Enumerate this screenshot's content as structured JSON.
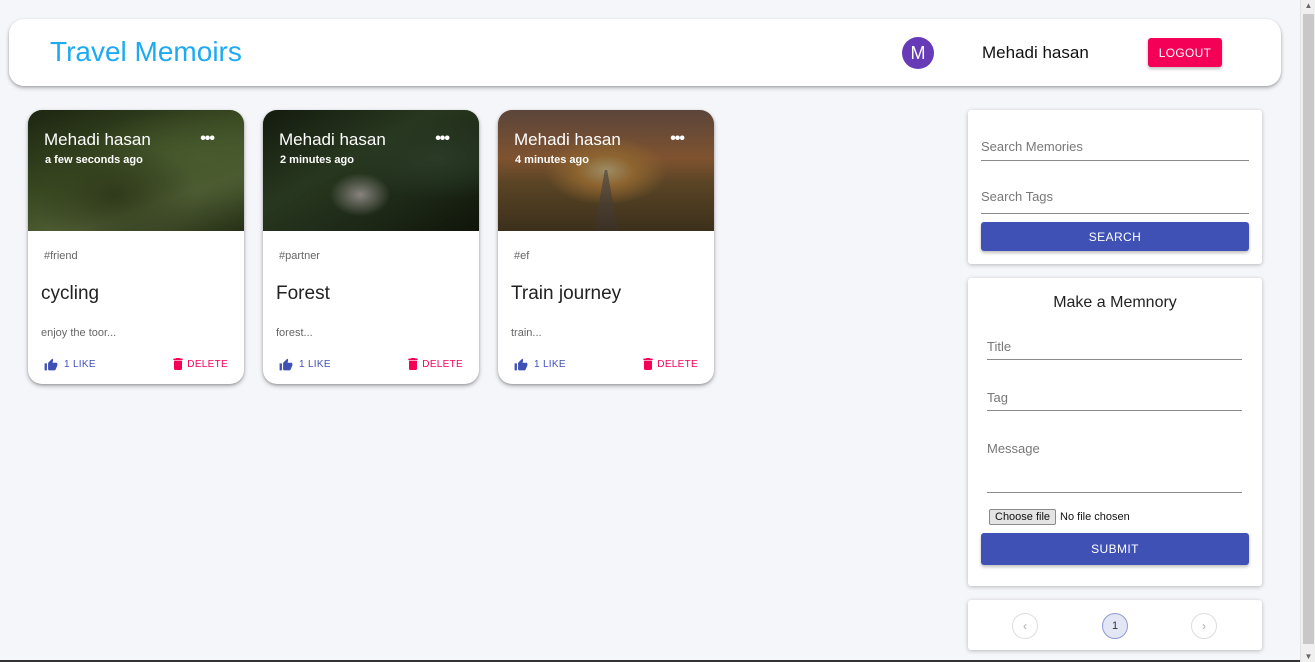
{
  "app": {
    "title": "Travel Memoirs",
    "avatar_letter": "M",
    "user_name": "Mehadi hasan",
    "logout_label": "LOGOUT",
    "brand_color": "#1eaaf1",
    "avatar_color": "#673ab7",
    "logout_color": "#f50057"
  },
  "posts": [
    {
      "author": "Mehadi hasan",
      "time": "a few seconds ago",
      "more_icon": "more-horizontal-icon",
      "tags": "#friend",
      "title": "cycling",
      "message": "enjoy the toor...",
      "like_label": "1 LIKE",
      "delete_label": "DELETE"
    },
    {
      "author": "Mehadi hasan",
      "time": "2 minutes ago",
      "more_icon": "more-horizontal-icon",
      "tags": "#partner",
      "title": "Forest",
      "message": "forest...",
      "like_label": "1 LIKE",
      "delete_label": "DELETE"
    },
    {
      "author": "Mehadi hasan",
      "time": "4 minutes ago",
      "more_icon": "more-horizontal-icon",
      "tags": "#ef",
      "title": "Train journey",
      "message": "train...",
      "like_label": "1 LIKE",
      "delete_label": "DELETE"
    }
  ],
  "search": {
    "memories_placeholder": "Search Memories",
    "tags_placeholder": "Search Tags",
    "button_label": "SEARCH"
  },
  "form": {
    "heading": "Make a Memnory",
    "title_placeholder": "Title",
    "tag_placeholder": "Tag",
    "message_placeholder": "Message",
    "file_button": "Choose file",
    "file_status": "No file chosen",
    "submit_label": "SUBMIT"
  },
  "pagination": {
    "current_page": "1",
    "prev_icon": "chevron-left-icon",
    "next_icon": "chevron-right-icon"
  },
  "colors": {
    "primary": "#3f51b5",
    "secondary": "#f50057"
  }
}
